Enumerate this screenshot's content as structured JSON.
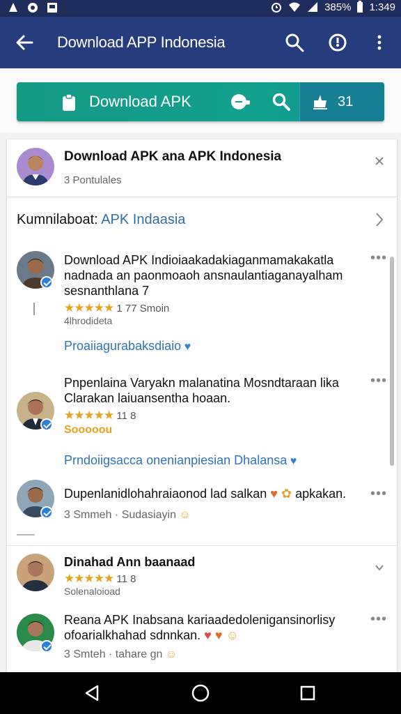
{
  "status": {
    "battery": "385%",
    "time": "1:349"
  },
  "app_bar": {
    "title": "Download APP Indonesia",
    "icons": [
      "arrow-back-icon",
      "search-icon",
      "compass-icon",
      "more-vert-icon"
    ]
  },
  "download_bar": {
    "label": "Download APK",
    "count": "31"
  },
  "header_card": {
    "title": "Download APK  ana APK Indonesia",
    "subtitle": "3 Pontulales"
  },
  "section": {
    "label": "Kumnilaboat:",
    "link": "APK Indaasia"
  },
  "posts": [
    {
      "text": "Download APK Indioiaakadakiaganmamakakatla nadnada an paonmoaoh ansnaulantiaganayalham sesnanthlana 7",
      "rating_count": "1 77  Smoin",
      "meta": "4lhrodideta",
      "link": "Proaiiagurabaksdiaio"
    },
    {
      "text": "Pnpenlaina Varyakn malanatina Mosndtaraan lika Clarakan laiuansentha hoaan.",
      "rating_count": "11 8",
      "meta": "Sooooou",
      "link": "Prndoiigsacca onenianpiesian Dhalansa"
    },
    {
      "text": "Dupenlanidlohahraiaonod lad salkan",
      "suffix": "apkakan.",
      "meta": "3 Smmeh · Sudasiayin"
    },
    {
      "title": "Dinahad Ann baanaad",
      "rating_count": "11 8",
      "meta": "Solenaloioad"
    },
    {
      "text": "Reana APK Inabsana kariaadedolenigansinorlisy ofoarialkhahad sdnnkan.",
      "meta": "3 Smteh · tahare gn"
    }
  ]
}
